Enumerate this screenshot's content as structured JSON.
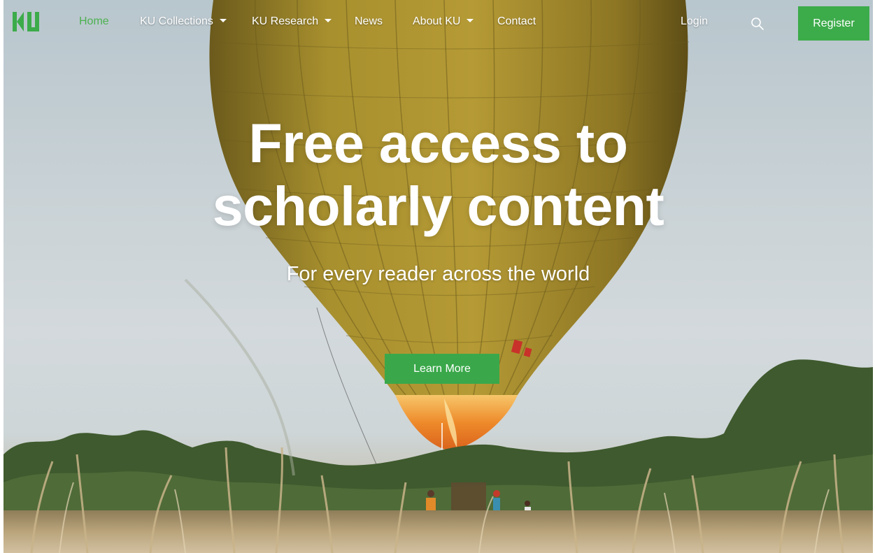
{
  "nav": {
    "logo_text": "KU",
    "items": [
      {
        "label": "Home",
        "active": true,
        "dropdown": false
      },
      {
        "label": "KU Collections",
        "active": false,
        "dropdown": true
      },
      {
        "label": "KU Research",
        "active": false,
        "dropdown": true
      },
      {
        "label": "News",
        "active": false,
        "dropdown": false
      },
      {
        "label": "About KU",
        "active": false,
        "dropdown": true
      },
      {
        "label": "Contact",
        "active": false,
        "dropdown": false
      }
    ],
    "login_label": "Login",
    "search_icon": "search-icon",
    "register_label": "Register"
  },
  "hero": {
    "headline_line1": "Free access to",
    "headline_line2": "scholarly content",
    "subheadline": "For every reader across the world",
    "cta_label": "Learn More"
  },
  "colors": {
    "accent": "#3cab4a",
    "active_nav": "#4db150",
    "text": "#ffffff"
  }
}
